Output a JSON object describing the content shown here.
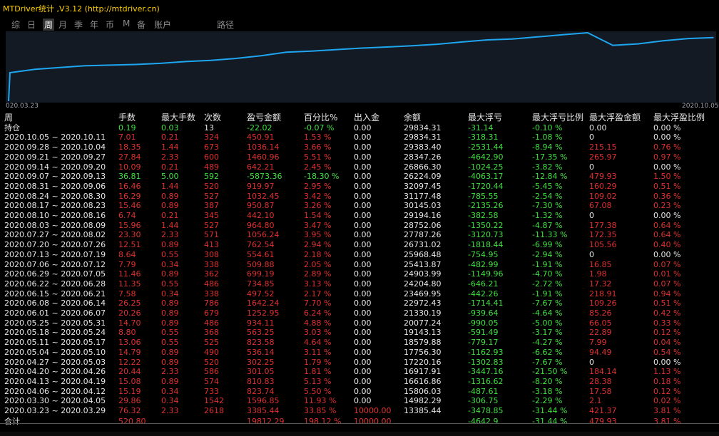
{
  "title": "MTDriver统计 ,V3.12 (http://mtdriver.cn)",
  "tabs": [
    "综",
    "日",
    "周",
    "月",
    "季",
    "年",
    "币",
    "M",
    "备",
    "账户",
    "路径"
  ],
  "active_tab": "周",
  "chart_data": {
    "type": "line",
    "x_start_label": "020.03.23",
    "x_end_label": "2020.10.05",
    "values": [
      13385.44,
      14982.29,
      15806.03,
      16616.86,
      16917.91,
      17220.16,
      17756.3,
      18579.88,
      19143.13,
      20077.24,
      21330.19,
      22972.43,
      23469.95,
      24204.8,
      24903.99,
      25413.87,
      25968.48,
      26731.02,
      27787.26,
      28752.06,
      29194.16,
      30145.03,
      31177.48,
      32097.45,
      26224.09,
      26866.3,
      28347.26,
      29383.4,
      29834.31
    ],
    "line_color": "#1ea6f0"
  },
  "columns": [
    "周",
    "手数",
    "最大手数",
    "次数",
    "盈亏金额",
    "百分比%",
    "出入金",
    "余额",
    "最大浮亏",
    "最大浮亏比例",
    "最大浮盈金额",
    "最大浮盈比例"
  ],
  "holding": {
    "label": "持仓",
    "lots": "0.19",
    "maxlots": "0.03",
    "count": "13",
    "pnl": "-22.02",
    "pct": "-0.07 %",
    "io": "0.00",
    "balance": "29834.31",
    "maxloss": "-31.14",
    "maxlosspct": "-0.10 %",
    "maxgain": "0.00",
    "maxgainpct": "0.00 %"
  },
  "rows": [
    {
      "week": "2020.10.05 ~ 2020.10.11",
      "lots": "7.01",
      "maxlots": "0.21",
      "count": "324",
      "pnl": "450.91",
      "pct": "1.53 %",
      "io": "0.00",
      "balance": "29834.31",
      "maxloss": "-318.31",
      "maxlosspct": "-1.08 %",
      "maxgain": "0",
      "maxgainpct": "0.00 %",
      "color": "red"
    },
    {
      "week": "2020.09.28 ~ 2020.10.04",
      "lots": "18.35",
      "maxlots": "1.44",
      "count": "673",
      "pnl": "1036.14",
      "pct": "3.66 %",
      "io": "0.00",
      "balance": "29383.40",
      "maxloss": "-2531.44",
      "maxlosspct": "-8.94 %",
      "maxgain": "215.15",
      "maxgainpct": "0.76 %",
      "color": "red"
    },
    {
      "week": "2020.09.21 ~ 2020.09.27",
      "lots": "27.84",
      "maxlots": "2.33",
      "count": "600",
      "pnl": "1460.96",
      "pct": "5.51 %",
      "io": "0.00",
      "balance": "28347.26",
      "maxloss": "-4642.90",
      "maxlosspct": "-17.35 %",
      "maxgain": "265.97",
      "maxgainpct": "0.97 %",
      "color": "red"
    },
    {
      "week": "2020.09.14 ~ 2020.09.20",
      "lots": "10.09",
      "maxlots": "0.21",
      "count": "489",
      "pnl": "642.21",
      "pct": "2.45 %",
      "io": "0.00",
      "balance": "26866.30",
      "maxloss": "-1024.25",
      "maxlosspct": "-3.82 %",
      "maxgain": "0",
      "maxgainpct": "0.00 %",
      "color": "red"
    },
    {
      "week": "2020.09.07 ~ 2020.09.13",
      "lots": "36.81",
      "maxlots": "5.00",
      "count": "592",
      "pnl": "-5873.36",
      "pct": "-18.30 %",
      "io": "0.00",
      "balance": "26224.09",
      "maxloss": "-4063.17",
      "maxlosspct": "-12.84 %",
      "maxgain": "479.93",
      "maxgainpct": "1.50 %",
      "color": "green"
    },
    {
      "week": "2020.08.31 ~ 2020.09.06",
      "lots": "16.46",
      "maxlots": "1.44",
      "count": "520",
      "pnl": "919.97",
      "pct": "2.95 %",
      "io": "0.00",
      "balance": "32097.45",
      "maxloss": "-1720.44",
      "maxlosspct": "-5.45 %",
      "maxgain": "160.29",
      "maxgainpct": "0.51 %",
      "color": "red"
    },
    {
      "week": "2020.08.24 ~ 2020.08.30",
      "lots": "16.29",
      "maxlots": "0.89",
      "count": "527",
      "pnl": "1032.45",
      "pct": "3.42 %",
      "io": "0.00",
      "balance": "31177.48",
      "maxloss": "-785.55",
      "maxlosspct": "-2.54 %",
      "maxgain": "109.02",
      "maxgainpct": "0.36 %",
      "color": "red"
    },
    {
      "week": "2020.08.17 ~ 2020.08.23",
      "lots": "15.46",
      "maxlots": "0.89",
      "count": "387",
      "pnl": "950.87",
      "pct": "3.26 %",
      "io": "0.00",
      "balance": "30145.03",
      "maxloss": "-2135.26",
      "maxlosspct": "-7.30 %",
      "maxgain": "67.08",
      "maxgainpct": "0.23 %",
      "color": "red"
    },
    {
      "week": "2020.08.10 ~ 2020.08.16",
      "lots": "6.74",
      "maxlots": "0.21",
      "count": "345",
      "pnl": "442.10",
      "pct": "1.54 %",
      "io": "0.00",
      "balance": "29194.16",
      "maxloss": "-382.58",
      "maxlosspct": "-1.32 %",
      "maxgain": "0",
      "maxgainpct": "0.00 %",
      "color": "red"
    },
    {
      "week": "2020.08.03 ~ 2020.08.09",
      "lots": "15.96",
      "maxlots": "1.44",
      "count": "527",
      "pnl": "964.80",
      "pct": "3.47 %",
      "io": "0.00",
      "balance": "28752.06",
      "maxloss": "-1350.22",
      "maxlosspct": "-4.87 %",
      "maxgain": "177.38",
      "maxgainpct": "0.64 %",
      "color": "red"
    },
    {
      "week": "2020.07.27 ~ 2020.08.02",
      "lots": "23.30",
      "maxlots": "2.33",
      "count": "571",
      "pnl": "1056.24",
      "pct": "3.95 %",
      "io": "0.00",
      "balance": "27787.26",
      "maxloss": "-3120.73",
      "maxlosspct": "-11.33 %",
      "maxgain": "172.35",
      "maxgainpct": "0.64 %",
      "color": "red"
    },
    {
      "week": "2020.07.20 ~ 2020.07.26",
      "lots": "12.51",
      "maxlots": "0.89",
      "count": "413",
      "pnl": "762.54",
      "pct": "2.94 %",
      "io": "0.00",
      "balance": "26731.02",
      "maxloss": "-1818.44",
      "maxlosspct": "-6.99 %",
      "maxgain": "105.56",
      "maxgainpct": "0.40 %",
      "color": "red"
    },
    {
      "week": "2020.07.13 ~ 2020.07.19",
      "lots": "8.64",
      "maxlots": "0.55",
      "count": "308",
      "pnl": "554.61",
      "pct": "2.18 %",
      "io": "0.00",
      "balance": "25968.48",
      "maxloss": "-754.95",
      "maxlosspct": "-2.94 %",
      "maxgain": "0",
      "maxgainpct": "0.00 %",
      "color": "red"
    },
    {
      "week": "2020.07.06 ~ 2020.07.12",
      "lots": "7.79",
      "maxlots": "0.34",
      "count": "338",
      "pnl": "509.88",
      "pct": "2.05 %",
      "io": "0.00",
      "balance": "25413.87",
      "maxloss": "-482.99",
      "maxlosspct": "-1.91 %",
      "maxgain": "16.85",
      "maxgainpct": "0.07 %",
      "color": "red"
    },
    {
      "week": "2020.06.29 ~ 2020.07.05",
      "lots": "11.46",
      "maxlots": "0.89",
      "count": "362",
      "pnl": "699.19",
      "pct": "2.89 %",
      "io": "0.00",
      "balance": "24903.99",
      "maxloss": "-1149.96",
      "maxlosspct": "-4.70 %",
      "maxgain": "1.98",
      "maxgainpct": "0.01 %",
      "color": "red"
    },
    {
      "week": "2020.06.22 ~ 2020.06.28",
      "lots": "11.35",
      "maxlots": "0.55",
      "count": "486",
      "pnl": "734.85",
      "pct": "3.13 %",
      "io": "0.00",
      "balance": "24204.80",
      "maxloss": "-646.21",
      "maxlosspct": "-2.72 %",
      "maxgain": "17.32",
      "maxgainpct": "0.07 %",
      "color": "red"
    },
    {
      "week": "2020.06.15 ~ 2020.06.21",
      "lots": "7.58",
      "maxlots": "0.34",
      "count": "338",
      "pnl": "497.52",
      "pct": "2.17 %",
      "io": "0.00",
      "balance": "23469.95",
      "maxloss": "-442.26",
      "maxlosspct": "-1.91 %",
      "maxgain": "218.91",
      "maxgainpct": "0.94 %",
      "color": "red"
    },
    {
      "week": "2020.06.08 ~ 2020.06.14",
      "lots": "26.25",
      "maxlots": "0.89",
      "count": "786",
      "pnl": "1642.24",
      "pct": "7.70 %",
      "io": "0.00",
      "balance": "22972.43",
      "maxloss": "-1714.41",
      "maxlosspct": "-7.67 %",
      "maxgain": "109.26",
      "maxgainpct": "0.51 %",
      "color": "red"
    },
    {
      "week": "2020.06.01 ~ 2020.06.07",
      "lots": "20.26",
      "maxlots": "0.89",
      "count": "679",
      "pnl": "1252.95",
      "pct": "6.24 %",
      "io": "0.00",
      "balance": "21330.19",
      "maxloss": "-939.64",
      "maxlosspct": "-4.64 %",
      "maxgain": "85.26",
      "maxgainpct": "0.42 %",
      "color": "red"
    },
    {
      "week": "2020.05.25 ~ 2020.05.31",
      "lots": "14.70",
      "maxlots": "0.89",
      "count": "486",
      "pnl": "934.11",
      "pct": "4.88 %",
      "io": "0.00",
      "balance": "20077.24",
      "maxloss": "-990.05",
      "maxlosspct": "-5.00 %",
      "maxgain": "66.05",
      "maxgainpct": "0.33 %",
      "color": "red"
    },
    {
      "week": "2020.05.18 ~ 2020.05.24",
      "lots": "8.80",
      "maxlots": "0.55",
      "count": "368",
      "pnl": "563.25",
      "pct": "3.03 %",
      "io": "0.00",
      "balance": "19143.13",
      "maxloss": "-591.49",
      "maxlosspct": "-3.17 %",
      "maxgain": "22.89",
      "maxgainpct": "0.12 %",
      "color": "red"
    },
    {
      "week": "2020.05.11 ~ 2020.05.17",
      "lots": "13.06",
      "maxlots": "0.55",
      "count": "525",
      "pnl": "823.58",
      "pct": "4.64 %",
      "io": "0.00",
      "balance": "18579.88",
      "maxloss": "-779.17",
      "maxlosspct": "-4.27 %",
      "maxgain": "7.99",
      "maxgainpct": "0.04 %",
      "color": "red"
    },
    {
      "week": "2020.05.04 ~ 2020.05.10",
      "lots": "14.79",
      "maxlots": "0.89",
      "count": "490",
      "pnl": "536.14",
      "pct": "3.11 %",
      "io": "0.00",
      "balance": "17756.30",
      "maxloss": "-1162.93",
      "maxlosspct": "-6.62 %",
      "maxgain": "94.49",
      "maxgainpct": "0.54 %",
      "color": "red"
    },
    {
      "week": "2020.04.27 ~ 2020.05.03",
      "lots": "12.22",
      "maxlots": "0.89",
      "count": "520",
      "pnl": "302.25",
      "pct": "1.79 %",
      "io": "0.00",
      "balance": "17220.16",
      "maxloss": "-1302.83",
      "maxlosspct": "-7.67 %",
      "maxgain": "0",
      "maxgainpct": "0.00 %",
      "color": "red"
    },
    {
      "week": "2020.04.20 ~ 2020.04.26",
      "lots": "20.44",
      "maxlots": "2.33",
      "count": "586",
      "pnl": "301.05",
      "pct": "1.81 %",
      "io": "0.00",
      "balance": "16917.91",
      "maxloss": "-3447.16",
      "maxlosspct": "-21.50 %",
      "maxgain": "184.14",
      "maxgainpct": "1.13 %",
      "color": "red"
    },
    {
      "week": "2020.04.13 ~ 2020.04.19",
      "lots": "15.08",
      "maxlots": "0.89",
      "count": "574",
      "pnl": "810.83",
      "pct": "5.13 %",
      "io": "0.00",
      "balance": "16616.86",
      "maxloss": "-1316.62",
      "maxlosspct": "-8.20 %",
      "maxgain": "28.38",
      "maxgainpct": "0.18 %",
      "color": "red"
    },
    {
      "week": "2020.04.06 ~ 2020.04.12",
      "lots": "15.19",
      "maxlots": "0.34",
      "count": "733",
      "pnl": "823.74",
      "pct": "5.50 %",
      "io": "0.00",
      "balance": "15806.03",
      "maxloss": "-487.61",
      "maxlosspct": "-3.18 %",
      "maxgain": "17.58",
      "maxgainpct": "0.12 %",
      "color": "red"
    },
    {
      "week": "2020.03.30 ~ 2020.04.05",
      "lots": "29.86",
      "maxlots": "0.34",
      "count": "1542",
      "pnl": "1596.85",
      "pct": "11.93 %",
      "io": "0.00",
      "balance": "14982.29",
      "maxloss": "-306.75",
      "maxlosspct": "-2.29 %",
      "maxgain": "2.1",
      "maxgainpct": "0.02 %",
      "color": "red"
    },
    {
      "week": "2020.03.23 ~ 2020.03.29",
      "lots": "76.32",
      "maxlots": "2.33",
      "count": "2618",
      "pnl": "3385.44",
      "pct": "33.85 %",
      "io": "10000.00",
      "balance": "13385.44",
      "maxloss": "-3478.85",
      "maxlosspct": "-31.44 %",
      "maxgain": "421.37",
      "maxgainpct": "3.81 %",
      "color": "red"
    }
  ],
  "total": {
    "label": "合计",
    "lots": "520.80",
    "maxlots": "",
    "count": "",
    "pnl": "19812.29",
    "pct": "198.12 %",
    "io": "10000.00",
    "balance": "",
    "maxloss": "-4642.9",
    "maxlosspct": "-31.44 %",
    "maxgain": "479.93",
    "maxgainpct": "3.81 %"
  }
}
